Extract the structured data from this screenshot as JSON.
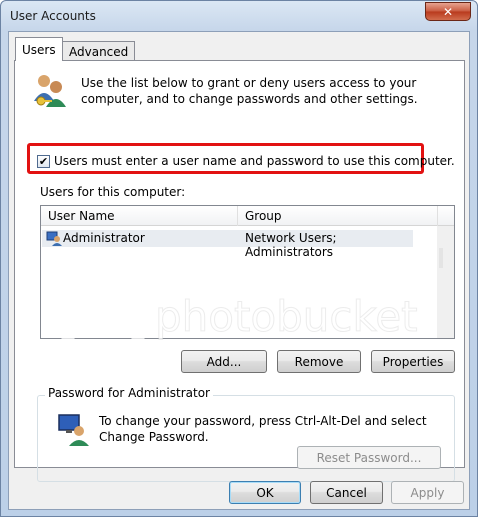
{
  "window": {
    "title": "User Accounts",
    "close_glyph": "✕"
  },
  "tabs": [
    {
      "label": "Users",
      "active": true
    },
    {
      "label": "Advanced",
      "active": false
    }
  ],
  "description": "Use the list below to grant or deny users access to your computer, and to change passwords and other settings.",
  "require_login": {
    "checked": true,
    "label": "Users must enter a user name and password to use this computer."
  },
  "users_label": "Users for this computer:",
  "user_list": {
    "columns": [
      "User Name",
      "Group"
    ],
    "rows": [
      {
        "name": "Administrator",
        "group": "Network Users; Administrators"
      }
    ]
  },
  "list_buttons": {
    "add": "Add...",
    "remove": "Remove",
    "properties": "Properties"
  },
  "password_group": {
    "title": "Password for Administrator",
    "text": "To change your password, press Ctrl-Alt-Del and select Change Password.",
    "reset_button": "Reset Password..."
  },
  "dialog_buttons": {
    "ok": "OK",
    "cancel": "Cancel",
    "apply": "Apply"
  },
  "watermark": "photobucket",
  "colors": {
    "highlight_border": "#e21111",
    "close_button": "#c95a3f",
    "window_frame": "#c6d6ea"
  }
}
